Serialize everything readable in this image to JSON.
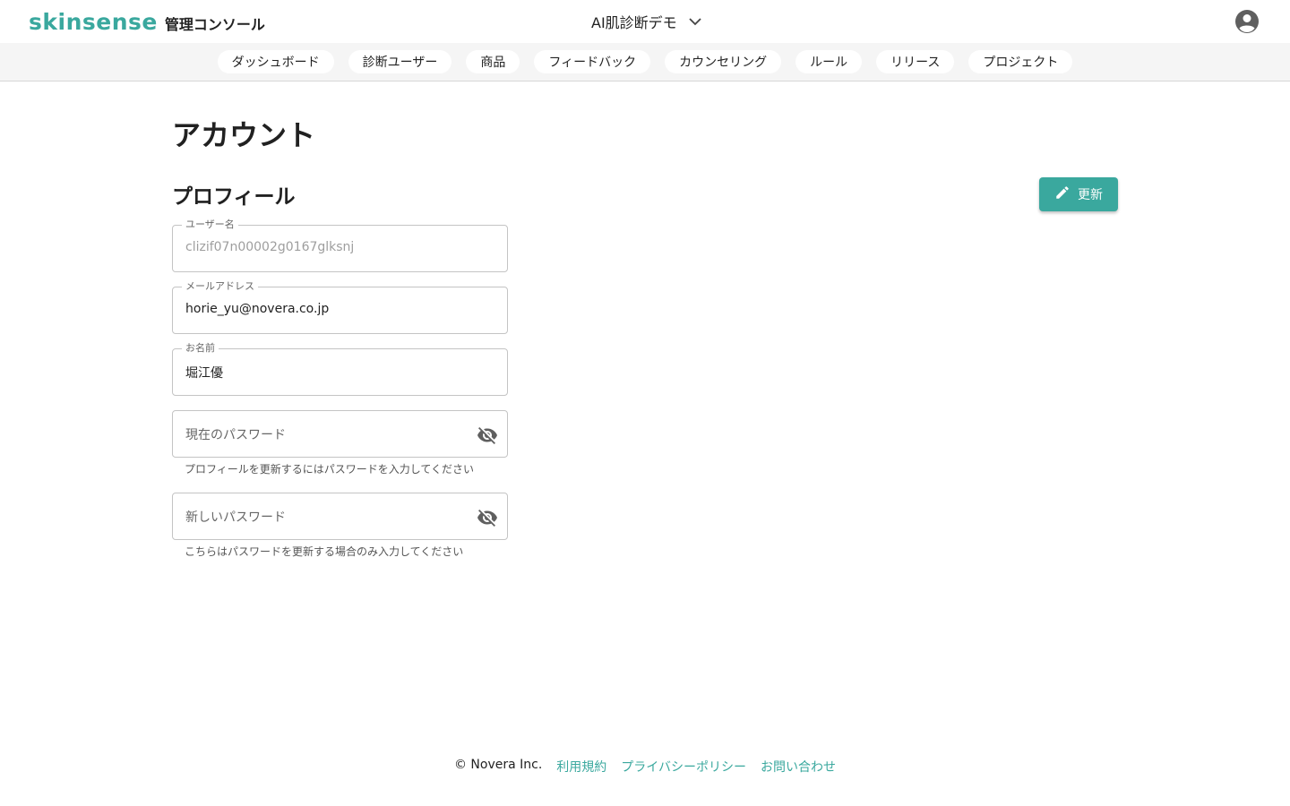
{
  "header": {
    "brand": "skinsense",
    "brand_sub": "管理コンソール",
    "project_name": "AI肌診断デモ",
    "chevron_icon": "chevron-down-icon",
    "account_icon": "account-circle-icon"
  },
  "nav": {
    "items": [
      {
        "label": "ダッシュボード"
      },
      {
        "label": "診断ユーザー"
      },
      {
        "label": "商品"
      },
      {
        "label": "フィードバック"
      },
      {
        "label": "カウンセリング"
      },
      {
        "label": "ルール"
      },
      {
        "label": "リリース"
      },
      {
        "label": "プロジェクト"
      }
    ]
  },
  "main": {
    "page_title": "アカウント",
    "section_title": "プロフィール",
    "update_button": {
      "label": "更新",
      "icon": "pencil-icon"
    },
    "fields": {
      "username": {
        "label": "ユーザー名",
        "value": "clizif07n00002g0167glksnj"
      },
      "email": {
        "label": "メールアドレス",
        "value": "horie_yu@novera.co.jp"
      },
      "name": {
        "label": "お名前",
        "value": "堀江優"
      },
      "current_password": {
        "placeholder": "現在のパスワード",
        "helper": "プロフィールを更新するにはパスワードを入力してください",
        "icon": "visibility-off-icon"
      },
      "new_password": {
        "placeholder": "新しいパスワード",
        "helper": "こちらはパスワードを更新する場合のみ入力してください",
        "icon": "visibility-off-icon"
      }
    }
  },
  "footer": {
    "copyright": "© Novera Inc.",
    "links": [
      {
        "label": "利用規約"
      },
      {
        "label": "プライバシーポリシー"
      },
      {
        "label": "お問い合わせ"
      }
    ]
  },
  "colors": {
    "accent": "#3aa89e",
    "nav_bg": "#f5f5f5"
  }
}
